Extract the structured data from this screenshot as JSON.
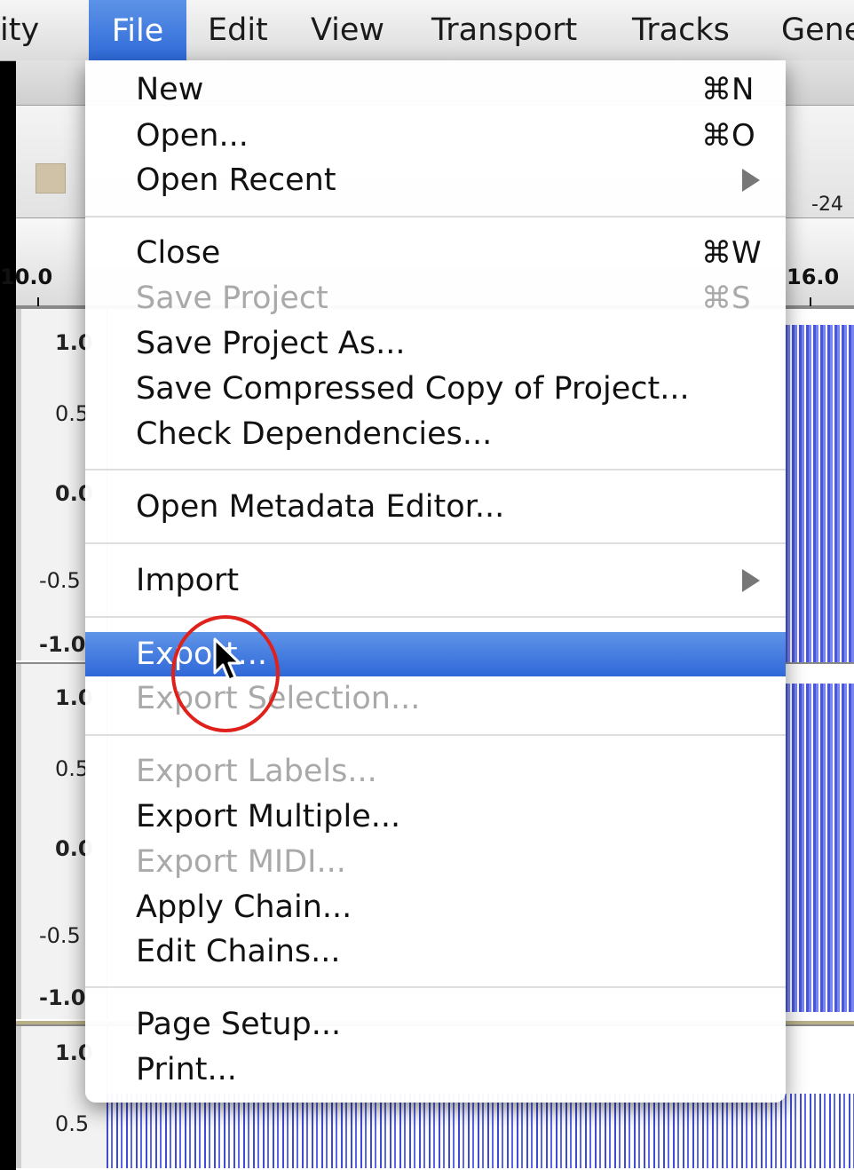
{
  "menubar": {
    "items": [
      {
        "label": "ity",
        "active": false
      },
      {
        "label": "File",
        "active": true
      },
      {
        "label": "Edit",
        "active": false
      },
      {
        "label": "View",
        "active": false
      },
      {
        "label": "Transport",
        "active": false
      },
      {
        "label": "Tracks",
        "active": false
      },
      {
        "label": "Gene",
        "active": false
      }
    ]
  },
  "toolbar": {
    "meter_label": "-24"
  },
  "ruler": {
    "left_label": "10.0",
    "right_label": "16.0"
  },
  "tracks": {
    "track1": [
      "1.0",
      "0.5",
      "0.0",
      "-0.5",
      "-1.0"
    ],
    "track2": [
      "1.0",
      "0.5",
      "0.0",
      "-0.5",
      "-1.0"
    ],
    "track3": [
      "1.0",
      "0.5"
    ]
  },
  "file_menu": {
    "new": {
      "label": "New",
      "shortcut": "⌘N"
    },
    "open": {
      "label": "Open...",
      "shortcut": "⌘O"
    },
    "open_recent": {
      "label": "Open Recent"
    },
    "close": {
      "label": "Close",
      "shortcut": "⌘W"
    },
    "save_project": {
      "label": "Save Project",
      "shortcut": "⌘S"
    },
    "save_project_as": {
      "label": "Save Project As..."
    },
    "save_compressed": {
      "label": "Save Compressed Copy of Project..."
    },
    "check_dependencies": {
      "label": "Check Dependencies..."
    },
    "metadata_editor": {
      "label": "Open Metadata Editor..."
    },
    "import": {
      "label": "Import"
    },
    "export": {
      "label": "Export..."
    },
    "export_selection": {
      "label": "Export Selection..."
    },
    "export_labels": {
      "label": "Export Labels..."
    },
    "export_multiple": {
      "label": "Export Multiple..."
    },
    "export_midi": {
      "label": "Export MIDI..."
    },
    "apply_chain": {
      "label": "Apply Chain..."
    },
    "edit_chains": {
      "label": "Edit Chains..."
    },
    "page_setup": {
      "label": "Page Setup..."
    },
    "print": {
      "label": "Print..."
    }
  },
  "colors": {
    "selection": "#2f67d8",
    "highlight_circle": "#e0211b",
    "waveform": "#4a56d6"
  },
  "icons": {
    "submenu": "chevron-right-icon",
    "cursor": "arrow-cursor-icon"
  }
}
